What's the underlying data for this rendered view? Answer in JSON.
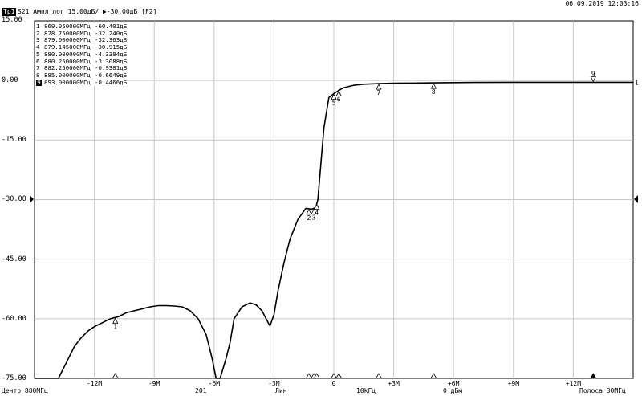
{
  "header": {
    "trace_badge": "Тр1",
    "trace_info": "S21 Ампл лог 15.00дБ/ ▶-30.00дБ [F2]",
    "datetime": "06.09.2019 12:03:16"
  },
  "y_axis": {
    "labels": [
      "15.00",
      "0.00",
      "-15.00",
      "-30.00",
      "-45.00",
      "-60.00",
      "-75.00"
    ]
  },
  "x_axis": {
    "tick_labels": [
      "-12M",
      "-9M",
      "-6M",
      "-3M",
      "0",
      "+3M",
      "+6M",
      "+9M",
      "+12M"
    ]
  },
  "markers": [
    {
      "num": "1",
      "freq": "869.050000МГц",
      "value": "-60.401дБ"
    },
    {
      "num": "2",
      "freq": "878.750000МГц",
      "value": "-32.240дБ"
    },
    {
      "num": "3",
      "freq": "879.000000МГц",
      "value": "-32.363дБ"
    },
    {
      "num": "4",
      "freq": "879.145000МГц",
      "value": "-30.915дБ"
    },
    {
      "num": "5",
      "freq": "880.000000МГц",
      "value": "-4.3384дБ"
    },
    {
      "num": "6",
      "freq": "880.250000МГц",
      "value": "-3.3088дБ"
    },
    {
      "num": "7",
      "freq": "882.250000МГц",
      "value": "-0.9381дБ"
    },
    {
      "num": "8",
      "freq": "885.000000МГц",
      "value": "-0.6649дБ"
    },
    {
      "num": "9",
      "freq": "893.000000МГц",
      "value": "-0.4466дБ",
      "active": true
    }
  ],
  "marker_plot_labels": [
    "1",
    "2",
    "3",
    "4",
    "5",
    "6",
    "7",
    "8",
    "9"
  ],
  "trace_end_label": "1",
  "footer": {
    "center": "Центр 880МГц",
    "points": "201",
    "scale": "Лин",
    "ifbw": "10kГц",
    "power": "0 дБм",
    "span": "Полоса 30МГц"
  },
  "chart_data": {
    "type": "line",
    "x_unit": "MHz offset from 880MHz",
    "y_unit": "dB",
    "xlim": [
      -15,
      15
    ],
    "ylim": [
      -75,
      15
    ],
    "grid": true,
    "series": [
      {
        "x": [
          -15,
          -14.5,
          -13.8,
          -13.4,
          -13.0,
          -12.7,
          -12.3,
          -12.0,
          -11.6,
          -11.2,
          -10.8,
          -10.4,
          -10.0,
          -9.6,
          -9.2,
          -8.8,
          -8.4,
          -8.0,
          -7.6,
          -7.2,
          -6.8,
          -6.4,
          -6.1,
          -5.9,
          -5.8,
          -5.7,
          -5.4,
          -5.2,
          -5.0,
          -4.6,
          -4.2,
          -3.9,
          -3.6,
          -3.4,
          -3.2,
          -3.0,
          -2.8,
          -2.5,
          -2.2,
          -1.8,
          -1.4,
          -1.1,
          -0.9,
          -0.85,
          -0.8,
          -0.5,
          -0.25,
          0,
          0.25,
          0.5,
          1.0,
          1.5,
          2.25,
          3.0,
          4.0,
          5.0,
          7.0,
          9.0,
          11.0,
          13.0,
          15.0
        ],
        "y": [
          -75,
          -75,
          -75,
          -71,
          -67,
          -65,
          -63,
          -62,
          -61,
          -60,
          -59.5,
          -58.5,
          -58,
          -57.5,
          -57,
          -56.7,
          -56.7,
          -56.8,
          -57,
          -58,
          -60,
          -64,
          -70,
          -75,
          -75,
          -75,
          -70,
          -66,
          -60,
          -57,
          -56,
          -56.5,
          -58,
          -60,
          -61.8,
          -59,
          -53,
          -46,
          -40,
          -35,
          -32.2,
          -32.4,
          -32,
          -30.9,
          -30,
          -12,
          -4.3,
          -3.3,
          -2.5,
          -1.8,
          -1.2,
          -0.94,
          -0.8,
          -0.7,
          -0.66,
          -0.6,
          -0.5,
          -0.45,
          -0.45,
          -0.45,
          -0.45
        ]
      }
    ],
    "marker_x": [
      -10.95,
      -1.25,
      -1.0,
      -0.855,
      0,
      0.25,
      2.25,
      5.0,
      13.0
    ]
  }
}
